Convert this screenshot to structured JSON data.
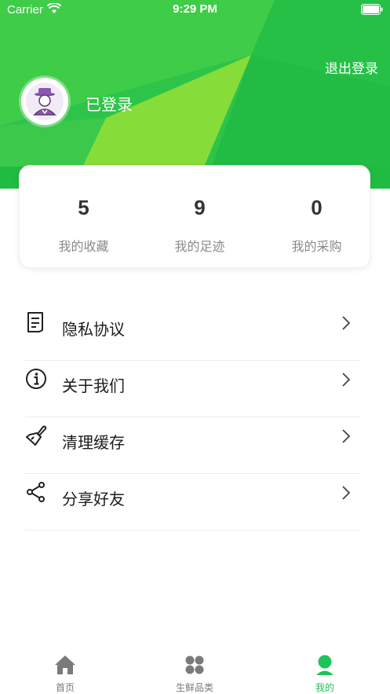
{
  "status_bar": {
    "carrier": "Carrier",
    "time": "9:29 PM"
  },
  "header": {
    "logout_label": "退出登录",
    "user_name": "已登录"
  },
  "stats": [
    {
      "value": "5",
      "label": "我的收藏"
    },
    {
      "value": "9",
      "label": "我的足迹"
    },
    {
      "value": "0",
      "label": "我的采购"
    }
  ],
  "menu": [
    {
      "label": "隐私协议",
      "icon": "document-icon"
    },
    {
      "label": "关于我们",
      "icon": "info-icon"
    },
    {
      "label": "清理缓存",
      "icon": "broom-icon"
    },
    {
      "label": "分享好友",
      "icon": "share-icon"
    }
  ],
  "tabbar": [
    {
      "label": "首页",
      "icon": "home-icon",
      "active": false
    },
    {
      "label": "生鲜品类",
      "icon": "grid-icon",
      "active": false
    },
    {
      "label": "我的",
      "icon": "user-icon",
      "active": true
    }
  ],
  "colors": {
    "accent": "#1fc35a",
    "header_green": "#21bd43",
    "light_green": "#85dd3a"
  }
}
